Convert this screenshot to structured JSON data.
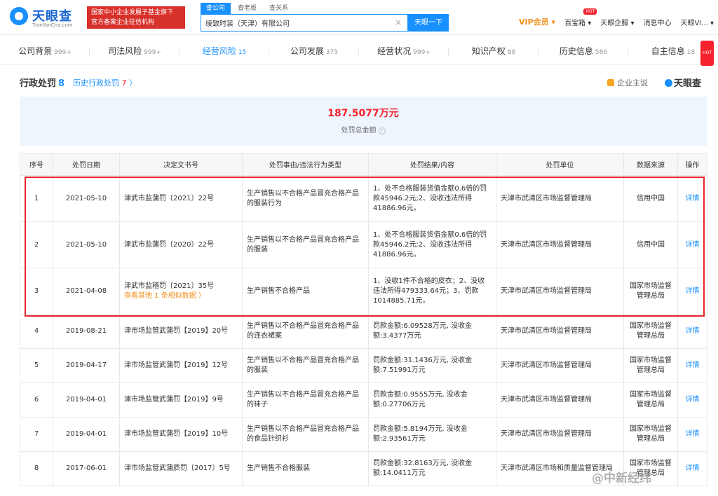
{
  "header": {
    "logo_text": "天眼查",
    "logo_url": "TianYanCha.com",
    "promo_line1": "国家中小企业发展子基金旗下",
    "promo_line2": "官方备案企业征信机构",
    "search_tabs": [
      "查公司",
      "查老板",
      "查关系"
    ],
    "search_value": "绫致时装（天津）有限公司",
    "search_button": "天眼一下",
    "nav": {
      "vip": "VIP会员",
      "baibaoxiang": "百宝箱",
      "hot": "HOT",
      "enterprise": "天眼企服",
      "messages": "消息中心",
      "user": "天眼VI..."
    }
  },
  "tabs": [
    {
      "label": "公司背景",
      "count": "999+"
    },
    {
      "label": "司法风险",
      "count": "999+"
    },
    {
      "label": "经营风险",
      "count": "15"
    },
    {
      "label": "公司发展",
      "count": "375"
    },
    {
      "label": "经营状况",
      "count": "999+"
    },
    {
      "label": "知识产权",
      "count": "88"
    },
    {
      "label": "历史信息",
      "count": "586"
    },
    {
      "label": "自主信息",
      "count": "18"
    }
  ],
  "section": {
    "title": "行政处罚",
    "count": "8",
    "history_label": "历史行政处罚",
    "history_count": "7",
    "corp_says": "企业主说",
    "brand": "天眼查"
  },
  "summary": {
    "amount": "187.5077万元",
    "label": "处罚总金额"
  },
  "table": {
    "headers": [
      "序号",
      "处罚日期",
      "决定文书号",
      "处罚事由/违法行为类型",
      "处罚结果/内容",
      "处罚单位",
      "数据来源",
      "操作"
    ],
    "rows": [
      {
        "no": "1",
        "date": "2021-05-10",
        "doc": "津武市监蒲罚〔2021〕22号",
        "reason": "生产销售以不合格产品冒充合格产品的服装行为",
        "result": "1、处不合格服装货值金额0.6倍的罚款45946.2元;2、没收违法所得41886.96元。",
        "unit": "天津市武清区市场监督管理局",
        "source": "信用中国",
        "action": "详情"
      },
      {
        "no": "2",
        "date": "2021-05-10",
        "doc": "津武市监蒲罚〔2020〕22号",
        "reason": "生产销售以不合格产品冒充合格产品的服装",
        "result": "1、处不合格服装货值金额0.6倍的罚款45946.2元;2、没收违法所得41886.96元。",
        "unit": "天津市武清区市场监督管理局",
        "source": "信用中国",
        "action": "详情"
      },
      {
        "no": "3",
        "date": "2021-04-08",
        "doc": "津武市监稽罚〔2021〕35号",
        "similar": "查看其他 1 条相似数据 〉",
        "reason": "生产销售不合格产品",
        "result": "1、没收1件不合格的皮衣；2、没收违法所得479333.64元；3、罚款1014885.71元。",
        "unit": "天津市武清区市场监督管理局",
        "source": "国家市场监督管理总局",
        "action": "详情"
      },
      {
        "no": "4",
        "date": "2019-08-21",
        "doc": "津市场监管武蒲罚【2019】20号",
        "reason": "生产销售以不合格产品冒充合格产品的连衣裙案",
        "result": "罚款金额:6.09528万元, 没收金额:3.4377万元",
        "unit": "天津市武清区市场监督管理局",
        "source": "国家市场监督管理总局",
        "action": "详情"
      },
      {
        "no": "5",
        "date": "2019-04-17",
        "doc": "津市场监管武蒲罚【2019】12号",
        "reason": "生产销售以不合格产品冒充合格产品的服装",
        "result": "罚款金额:31.1436万元, 没收金额:7.51991万元",
        "unit": "天津市武清区市场监督管理局",
        "source": "国家市场监督管理总局",
        "action": "详情"
      },
      {
        "no": "6",
        "date": "2019-04-01",
        "doc": "津市场监管武蒲罚【2019】9号",
        "reason": "生产销售以不合格产品冒充合格产品的袜子",
        "result": "罚款金额:0.9555万元, 没收金额:0.27706万元",
        "unit": "天津市武清区市场监督管理局",
        "source": "国家市场监督管理总局",
        "action": "详情"
      },
      {
        "no": "7",
        "date": "2019-04-01",
        "doc": "津市场监管武蒲罚【2019】10号",
        "reason": "生产销售以不合格产品冒充合格产品的食品针织衫",
        "result": "罚款金额:5.8194万元, 没收金额:2.93561万元",
        "unit": "天津市武清区市场监督管理局",
        "source": "国家市场监督管理总局",
        "action": "详情"
      },
      {
        "no": "8",
        "date": "2017-06-01",
        "doc": "津市场监管武蒲质罚〔2017〕5号",
        "reason": "生产销售不合格服装",
        "result": "罚款金额:32.8163万元, 没收金额:14.0411万元",
        "unit": "天津市武清区市场和质量监督管理局",
        "source": "国家市场监督管理总局",
        "action": "详情"
      }
    ]
  },
  "watermark": "@中新经纬",
  "colors": {
    "accent": "#1890ff",
    "alert": "#f5222d",
    "highlight_box": "#e8222a",
    "vip": "#f5901b"
  }
}
